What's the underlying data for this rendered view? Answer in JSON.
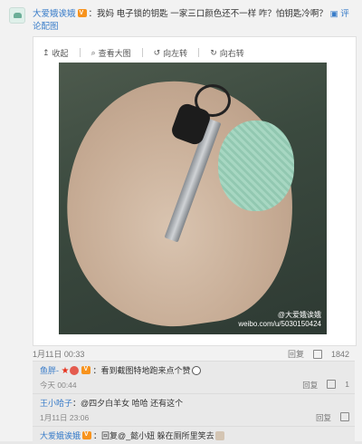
{
  "post": {
    "author": "大爱娥诶娥",
    "text": "：我妈  电子锁的钥匙  一家三口颜色还不一样  咋？怕钥匙冷啊？",
    "comment_link": "评论配图"
  },
  "toolbar": {
    "collapse": "收起",
    "view_large": "查看大图",
    "rotate_left": "向左转",
    "rotate_right": "向右转"
  },
  "watermark": {
    "name": "@大爱娥诶娥",
    "url": "weibo.com/u/5030150424"
  },
  "footer": {
    "date": "1月11日 00:33",
    "reply": "回复",
    "like_count": "1842"
  },
  "comments": [
    {
      "user": "鱼胖-",
      "text": "：看到截图特地跑来点个赞",
      "time": "今天 00:44",
      "reply": "回复",
      "likes": "1"
    },
    {
      "user": "王小哈子",
      "text": "：@四夕白羊女 哈哈 还有这个",
      "time": "1月11日 23:06",
      "reply": "回复",
      "likes": ""
    },
    {
      "user": "大爱娥诶娥",
      "text": "：回复@_懿小妞 躲在厕所里笑去",
      "time": "",
      "reply": "",
      "likes": ""
    }
  ]
}
